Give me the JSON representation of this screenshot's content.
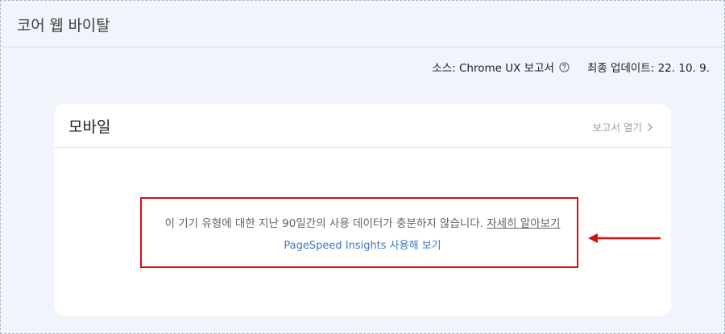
{
  "header": {
    "title": "코어 웹 바이탈"
  },
  "meta": {
    "source_label": "소스: Chrome UX 보고서",
    "help_icon": "help-circle-icon",
    "updated_label": "최종 업데이트: 22. 10. 9."
  },
  "card": {
    "title": "모바일",
    "open_report_label": "보고서 열기",
    "message": "이 기기 유형에 대한 지난 90일간의 사용 데이터가 충분하지 않습니다.",
    "learn_more_label": "자세히 알아보기",
    "psi_link_label": "PageSpeed Insights 사용해 보기"
  },
  "annotation": {
    "highlight_color": "#d40f0f",
    "arrow_icon": "arrow-left-icon"
  },
  "colors": {
    "background": "#f1f4fa",
    "card": "#ffffff",
    "link": "#3c78c8",
    "muted": "#9aa0a6"
  }
}
